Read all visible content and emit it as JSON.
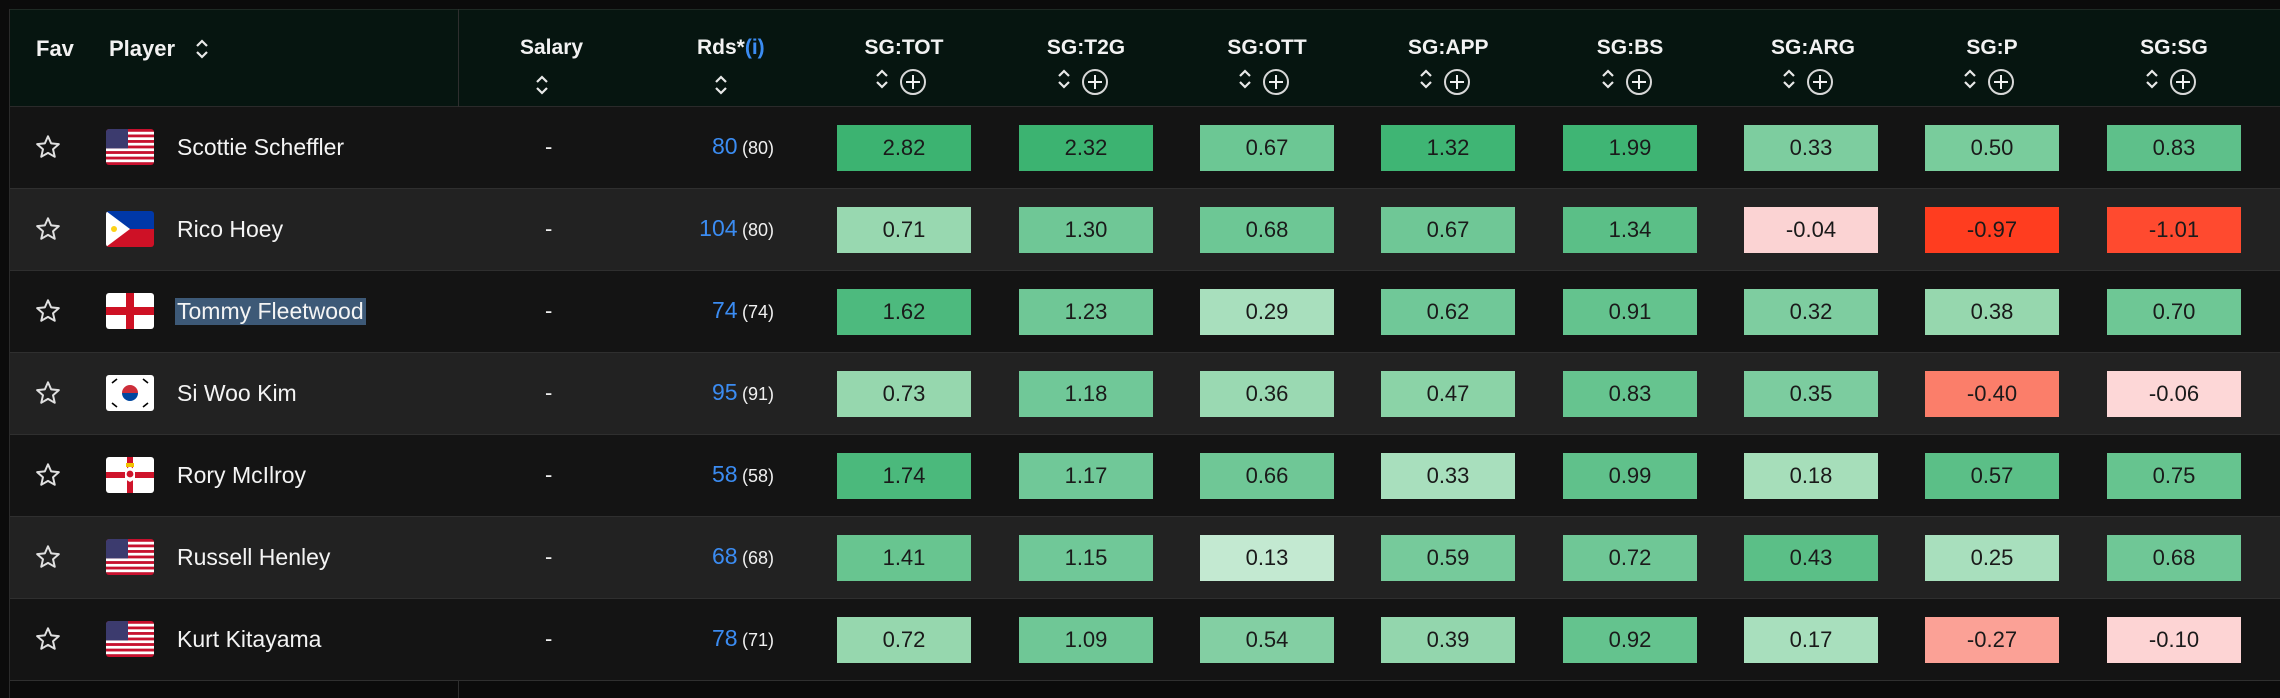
{
  "header": {
    "fav": "Fav",
    "player": "Player",
    "salary": "Salary",
    "rds": "Rds*",
    "rds_info": "(i)",
    "sg_columns": [
      "SG:TOT",
      "SG:T2G",
      "SG:OTT",
      "SG:APP",
      "SG:BS",
      "SG:ARG",
      "SG:P",
      "SG:SG"
    ]
  },
  "colors": {
    "header_bg": "#061510",
    "row_odd": "#141414",
    "row_even": "#222222",
    "link_blue": "#3b8cf2",
    "selection": "#3d5977"
  },
  "rows": [
    {
      "name": "Scottie Scheffler",
      "flag": "usa",
      "salary": "-",
      "rds": "80",
      "rds_sub": "(80)",
      "sg": [
        "2.82",
        "2.32",
        "0.67",
        "1.32",
        "1.99",
        "0.33",
        "0.50",
        "0.83"
      ],
      "colors": [
        "#3cb371",
        "#3cb371",
        "#6cc794",
        "#3fb574",
        "#3fb574",
        "#7dcd9f",
        "#79cc9c",
        "#5ec08a"
      ]
    },
    {
      "name": "Rico Hoey",
      "flag": "philippines",
      "salary": "-",
      "rds": "104",
      "rds_sub": "(80)",
      "sg": [
        "0.71",
        "1.30",
        "0.68",
        "0.67",
        "1.34",
        "-0.04",
        "-0.97",
        "-1.01"
      ],
      "colors": [
        "#98d8b0",
        "#6fc796",
        "#6dc795",
        "#6fc796",
        "#5bbf87",
        "#fbd3d3",
        "#ff3d1f",
        "#ff4a2f"
      ]
    },
    {
      "name": "Tommy Fleetwood",
      "flag": "england",
      "salary": "-",
      "rds": "74",
      "rds_sub": "(74)",
      "selected": true,
      "sg": [
        "1.62",
        "1.23",
        "0.29",
        "0.62",
        "0.91",
        "0.32",
        "0.38",
        "0.70"
      ],
      "colors": [
        "#4dba7e",
        "#6fc796",
        "#a8dfbd",
        "#70c898",
        "#64c38e",
        "#7ecda0",
        "#96d7ae",
        "#6ec795"
      ]
    },
    {
      "name": "Si Woo Kim",
      "flag": "korea",
      "salary": "-",
      "rds": "95",
      "rds_sub": "(91)",
      "sg": [
        "0.73",
        "1.18",
        "0.36",
        "0.47",
        "0.83",
        "0.35",
        "-0.40",
        "-0.06"
      ],
      "colors": [
        "#96d7ae",
        "#70c898",
        "#9ad9b2",
        "#8bd3a7",
        "#66c48f",
        "#7ccc9f",
        "#fb7e6a",
        "#fdd7d7"
      ]
    },
    {
      "name": "Rory McIlroy",
      "flag": "northern-ireland",
      "salary": "-",
      "rds": "58",
      "rds_sub": "(58)",
      "sg": [
        "1.74",
        "1.17",
        "0.66",
        "0.33",
        "0.99",
        "0.18",
        "0.57",
        "0.75"
      ],
      "colors": [
        "#4bb97c",
        "#70c898",
        "#6fc796",
        "#a8dfbd",
        "#60c18b",
        "#a6deba",
        "#5bbf87",
        "#66c48f"
      ]
    },
    {
      "name": "Russell Henley",
      "flag": "usa",
      "salary": "-",
      "rds": "68",
      "rds_sub": "(68)",
      "sg": [
        "1.41",
        "1.15",
        "0.13",
        "0.59",
        "0.72",
        "0.43",
        "0.25",
        "0.68"
      ],
      "colors": [
        "#68c590",
        "#70c898",
        "#c3e9d1",
        "#76ca9b",
        "#6fc796",
        "#5bbf87",
        "#a8dfbd",
        "#6fc796"
      ]
    },
    {
      "name": "Kurt Kitayama",
      "flag": "usa",
      "salary": "-",
      "rds": "78",
      "rds_sub": "(71)",
      "sg": [
        "0.72",
        "1.09",
        "0.54",
        "0.39",
        "0.92",
        "0.17",
        "-0.27",
        "-0.10"
      ],
      "colors": [
        "#96d7ae",
        "#6fc796",
        "#83cfa3",
        "#93d6ad",
        "#64c38e",
        "#a8dfbd",
        "#fba196",
        "#fdd4d4"
      ]
    }
  ]
}
